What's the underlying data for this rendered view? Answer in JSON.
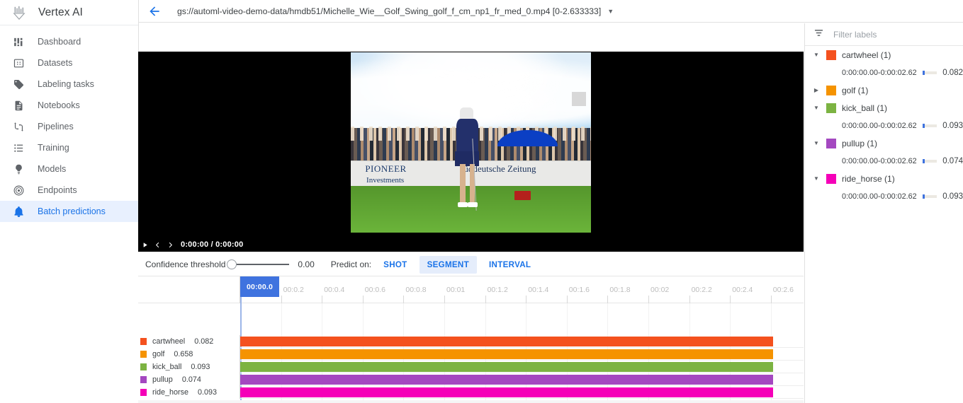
{
  "brand": {
    "title": "Vertex AI",
    "logo_icon": "vertex-ai-logo-icon"
  },
  "sidebar": {
    "items": [
      {
        "label": "Dashboard",
        "icon": "dashboard-icon",
        "active": false
      },
      {
        "label": "Datasets",
        "icon": "datasets-icon",
        "active": false
      },
      {
        "label": "Labeling tasks",
        "icon": "tag-icon",
        "active": false
      },
      {
        "label": "Notebooks",
        "icon": "notebook-icon",
        "active": false
      },
      {
        "label": "Pipelines",
        "icon": "pipelines-icon",
        "active": false
      },
      {
        "label": "Training",
        "icon": "list-icon",
        "active": false
      },
      {
        "label": "Models",
        "icon": "lightbulb-icon",
        "active": false
      },
      {
        "label": "Endpoints",
        "icon": "target-icon",
        "active": false
      },
      {
        "label": "Batch predictions",
        "icon": "bell-icon",
        "active": true
      }
    ]
  },
  "topbar": {
    "back_icon": "back-arrow-icon",
    "video_path": "gs://automl-video-demo-data/hmdb51/Michelle_Wie__Golf_Swing_golf_f_cm_np1_fr_med_0.mp4 [0-2.633333]",
    "caret_icon": "chevron-down-icon"
  },
  "player": {
    "play_icon": "play-icon",
    "prev_icon": "prev-frame-icon",
    "next_icon": "next-frame-icon",
    "time": "0:00:00 / 0:00:00",
    "frame_text": {
      "board1": "PIONEER",
      "board2": "Investments",
      "board3": "üddeutsche Zeitung"
    }
  },
  "controls": {
    "confidence_label": "Confidence threshold",
    "confidence_value": "0.00",
    "predict_on_label": "Predict on:",
    "predict_buttons": [
      {
        "label": "SHOT",
        "active": false
      },
      {
        "label": "SEGMENT",
        "active": true
      },
      {
        "label": "INTERVAL",
        "active": false
      }
    ]
  },
  "timeline": {
    "playhead_label": "00:00.0",
    "ticks": [
      "00:0.2",
      "00:0.4",
      "00:0.6",
      "00:0.8",
      "00:01",
      "00:1.2",
      "00:1.4",
      "00:1.6",
      "00:1.8",
      "00:02",
      "00:2.2",
      "00:2.4",
      "00:2.6"
    ],
    "rows": [
      {
        "name": "cartwheel",
        "score": "0.082",
        "color": "#f4511e",
        "bar_pct": 100
      },
      {
        "name": "golf",
        "score": "0.658",
        "color": "#f59300",
        "bar_pct": 100
      },
      {
        "name": "kick_ball",
        "score": "0.093",
        "color": "#7cb342",
        "bar_pct": 100
      },
      {
        "name": "pullup",
        "score": "0.074",
        "color": "#a448c0",
        "bar_pct": 100
      },
      {
        "name": "ride_horse",
        "score": "0.093",
        "color": "#f500b8",
        "bar_pct": 100
      }
    ]
  },
  "right_panel": {
    "filter_icon": "filter-icon",
    "filter_placeholder": "Filter labels",
    "groups": [
      {
        "name": "cartwheel (1)",
        "color": "#f4511e",
        "expanded": true,
        "segments": [
          {
            "range": "0:00:00.00-0:00:02.62",
            "score": "0.082",
            "fill_pct": 8
          }
        ]
      },
      {
        "name": "golf (1)",
        "color": "#f59300",
        "expanded": false,
        "segments": []
      },
      {
        "name": "kick_ball (1)",
        "color": "#7cb342",
        "expanded": true,
        "segments": [
          {
            "range": "0:00:00.00-0:00:02.62",
            "score": "0.093",
            "fill_pct": 9
          }
        ]
      },
      {
        "name": "pullup (1)",
        "color": "#a448c0",
        "expanded": true,
        "segments": [
          {
            "range": "0:00:00.00-0:00:02.62",
            "score": "0.074",
            "fill_pct": 7
          }
        ]
      },
      {
        "name": "ride_horse (1)",
        "color": "#f500b8",
        "expanded": true,
        "segments": [
          {
            "range": "0:00:00.00-0:00:02.62",
            "score": "0.093",
            "fill_pct": 9
          }
        ]
      }
    ]
  },
  "colors": {
    "accent_blue": "#1a73e8",
    "playhead_blue": "#3f73df",
    "active_nav_bg": "#e8f0fe"
  }
}
